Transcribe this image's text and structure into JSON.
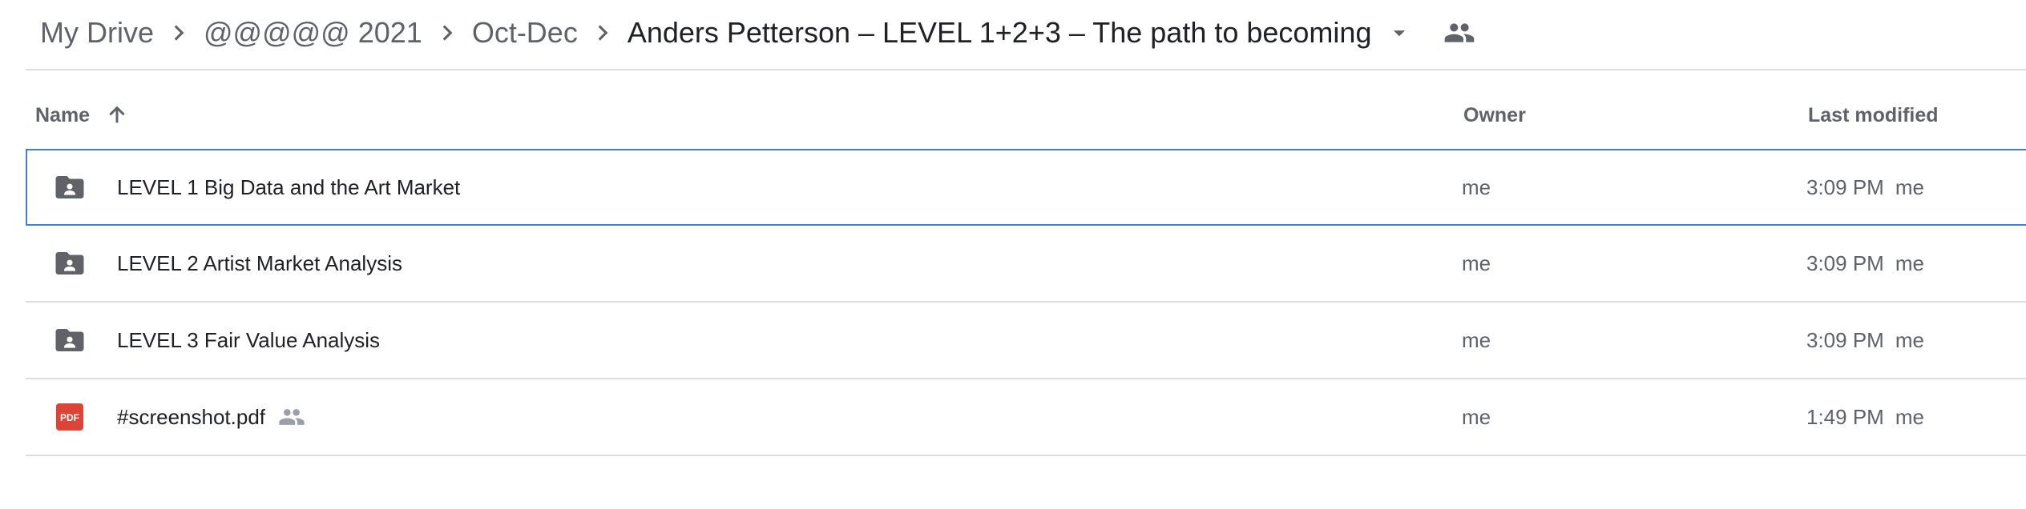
{
  "breadcrumb": {
    "items": [
      "My Drive",
      "@@@@@ 2021",
      "Oct-Dec"
    ],
    "current": "Anders Petterson – LEVEL 1+2+3 – The path to becoming"
  },
  "header": {
    "name": "Name",
    "owner": "Owner",
    "last_modified": "Last modified"
  },
  "files": [
    {
      "name": "LEVEL 1 Big Data and the Art Market",
      "icon": "shared-folder-icon",
      "owner": "me",
      "modified": "3:09 PM",
      "modified_by": "me",
      "selected": true
    },
    {
      "name": "LEVEL 2 Artist Market Analysis",
      "icon": "shared-folder-icon",
      "owner": "me",
      "modified": "3:09 PM",
      "modified_by": "me"
    },
    {
      "name": "LEVEL 3 Fair Value Analysis",
      "icon": "shared-folder-icon",
      "owner": "me",
      "modified": "3:09 PM",
      "modified_by": "me"
    },
    {
      "name": "#screenshot.pdf",
      "icon": "pdf-icon",
      "owner": "me",
      "modified": "1:49 PM",
      "modified_by": "me",
      "shared": true,
      "icon_label": "PDF"
    }
  ],
  "colors": {
    "selection_border": "#4a7bd4",
    "pdf_red": "#db4437",
    "folder_gray": "#5f6368"
  }
}
